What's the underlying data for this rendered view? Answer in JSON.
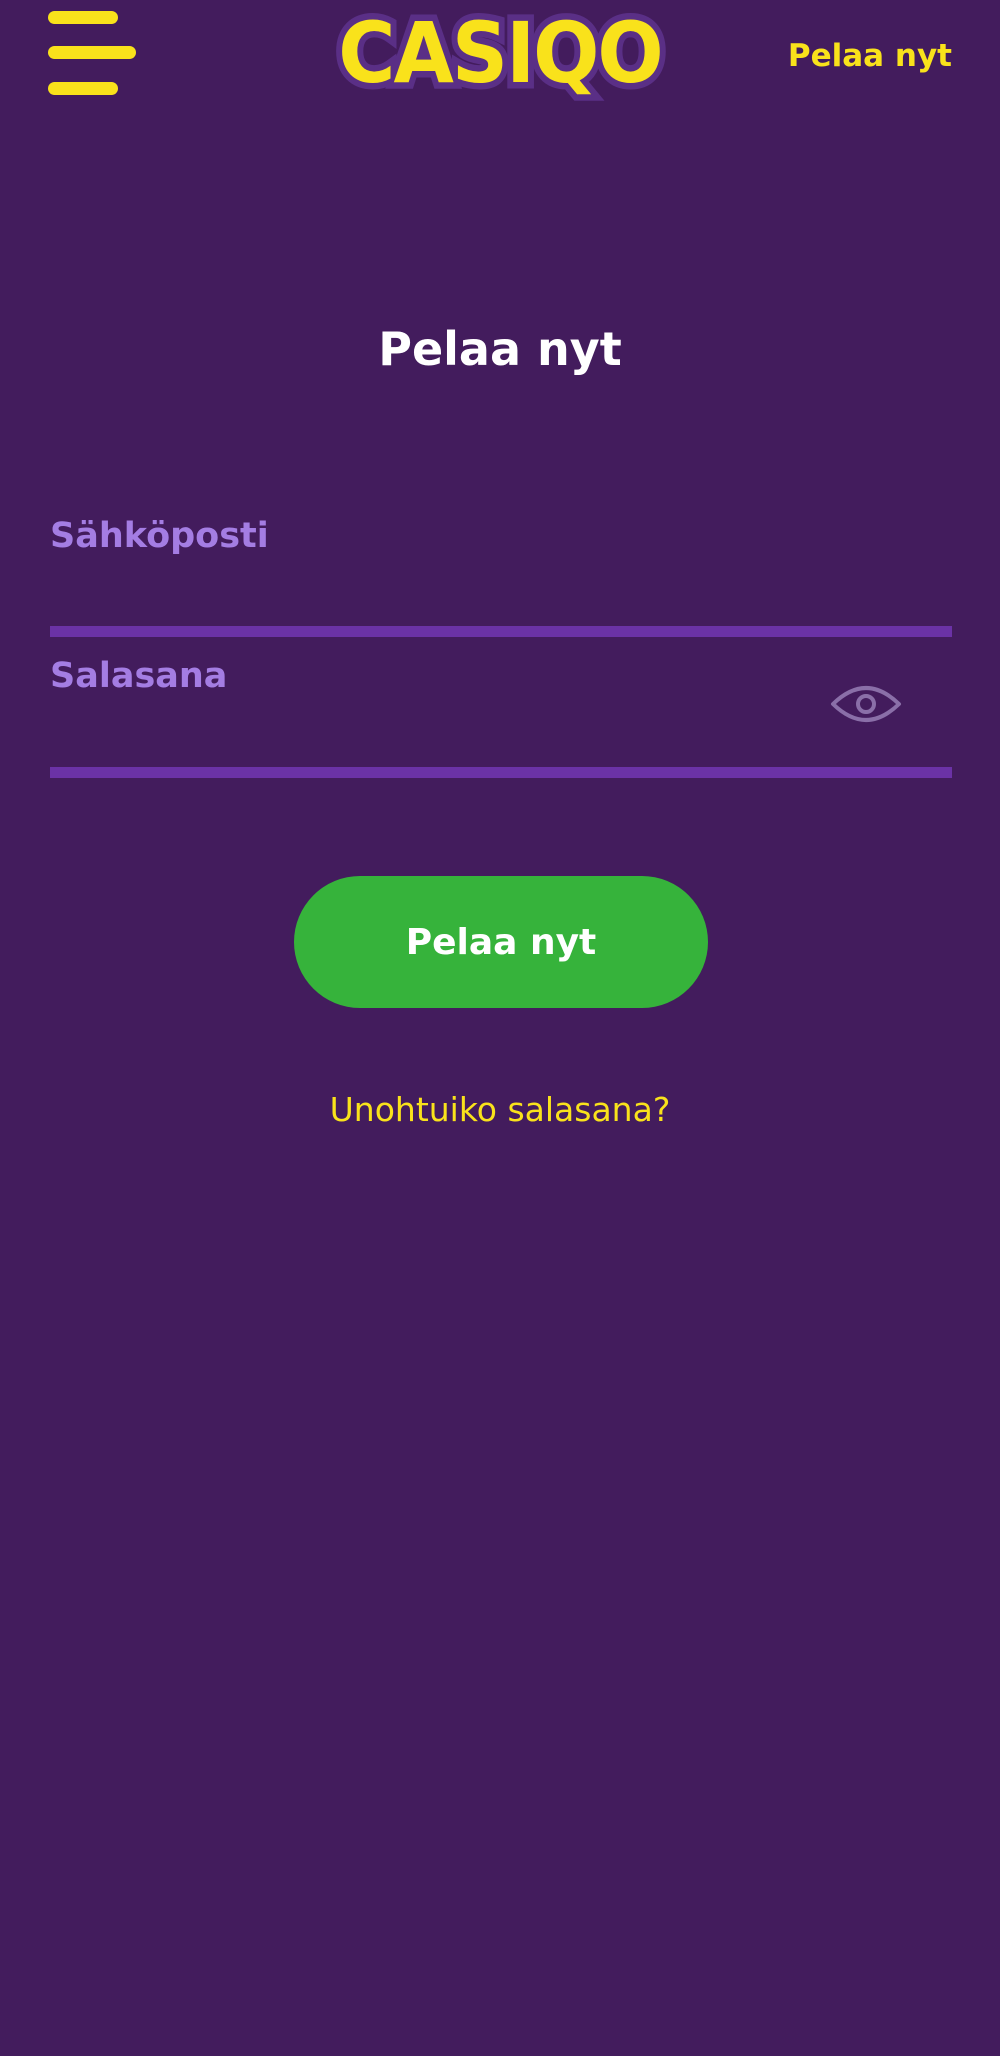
{
  "header": {
    "logo_text": "CASIQO",
    "cta_label": "Pelaa nyt"
  },
  "main": {
    "title": "Pelaa nyt",
    "email": {
      "label": "Sähköposti",
      "value": ""
    },
    "password": {
      "label": "Salasana",
      "value": ""
    },
    "submit_label": "Pelaa nyt",
    "forgot_password_label": "Unohtuiko salasana?"
  },
  "icons": {
    "menu": "hamburger-menu-icon",
    "password_toggle": "eye-icon"
  },
  "colors": {
    "background": "#431c5d",
    "accent_yellow": "#f9e21b",
    "label_purple": "#a47de3",
    "underline_purple": "#6b32a6",
    "button_green": "#36b33b",
    "text_white": "#ffffff"
  }
}
